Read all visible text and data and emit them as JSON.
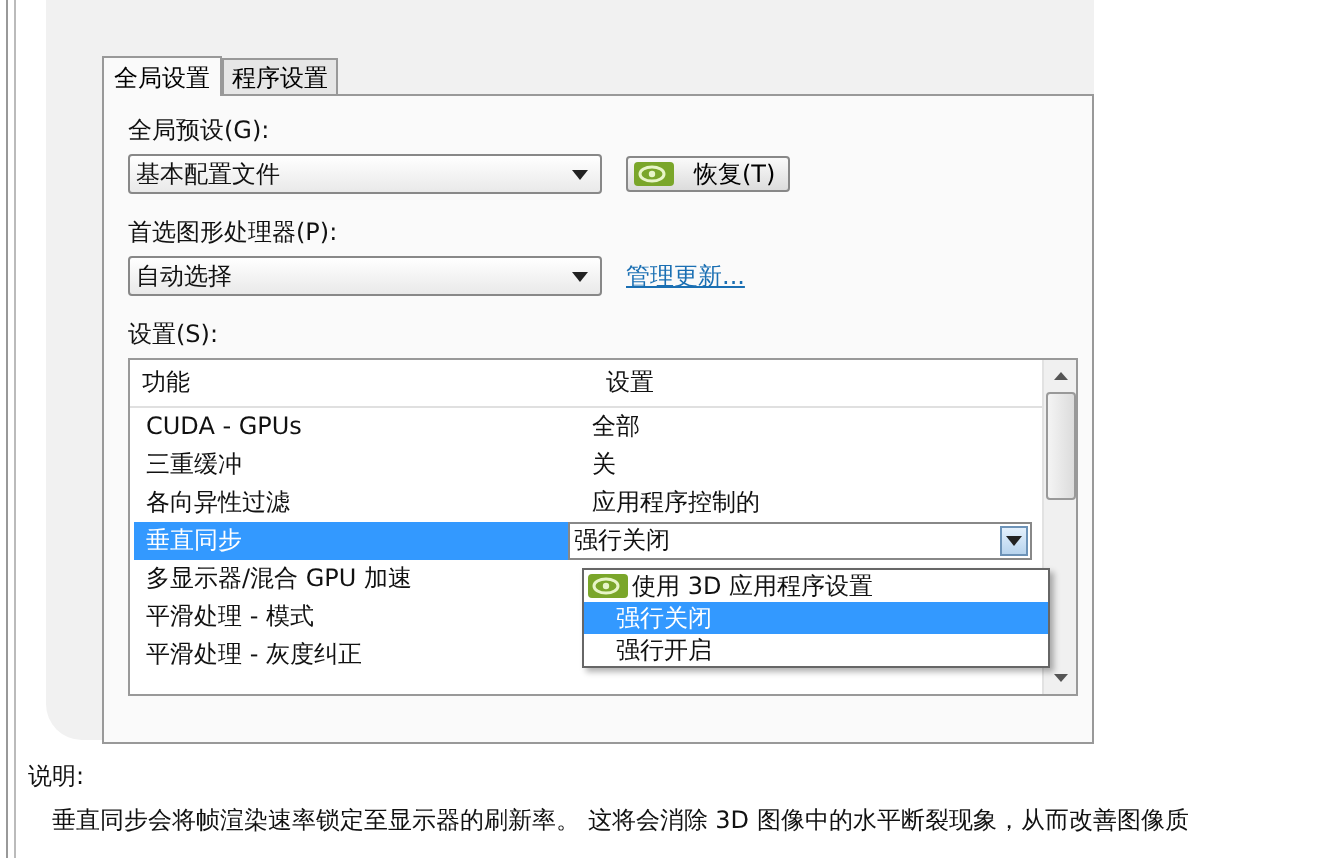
{
  "tabs": [
    {
      "label": "全局设置",
      "selected": true
    },
    {
      "label": "程序设置",
      "selected": false
    }
  ],
  "global_preset": {
    "label": "全局预设(G):",
    "value": "基本配置文件",
    "restore_button": "恢复(T)"
  },
  "preferred_gpu": {
    "label": "首选图形处理器(P):",
    "value": "自动选择",
    "link": "管理更新..."
  },
  "settings": {
    "label": "设置(S):",
    "columns": [
      "功能",
      "设置"
    ],
    "rows": [
      {
        "feature": "CUDA - GPUs",
        "setting": "全部",
        "selected": false
      },
      {
        "feature": "三重缓冲",
        "setting": "关",
        "selected": false
      },
      {
        "feature": "各向异性过滤",
        "setting": "应用程序控制的",
        "selected": false
      },
      {
        "feature": "垂直同步",
        "setting": "强行关闭",
        "selected": true
      },
      {
        "feature": "多显示器/混合 GPU 加速",
        "selected": false
      },
      {
        "feature": "平滑处理 - 模式",
        "selected": false
      },
      {
        "feature": "平滑处理 - 灰度纠正",
        "selected": false
      }
    ],
    "dropdown_options": [
      {
        "label": "使用 3D 应用程序设置",
        "kind": "nvidia",
        "selected": false
      },
      {
        "label": "强行关闭",
        "kind": "plain",
        "selected": true
      },
      {
        "label": "强行开启",
        "kind": "plain",
        "selected": false
      }
    ]
  },
  "description": {
    "label": "说明:",
    "text": "垂直同步会将帧渲染速率锁定至显示器的刷新率。 这将会消除 3D 图像中的水平断裂现象，从而改善图像质"
  }
}
